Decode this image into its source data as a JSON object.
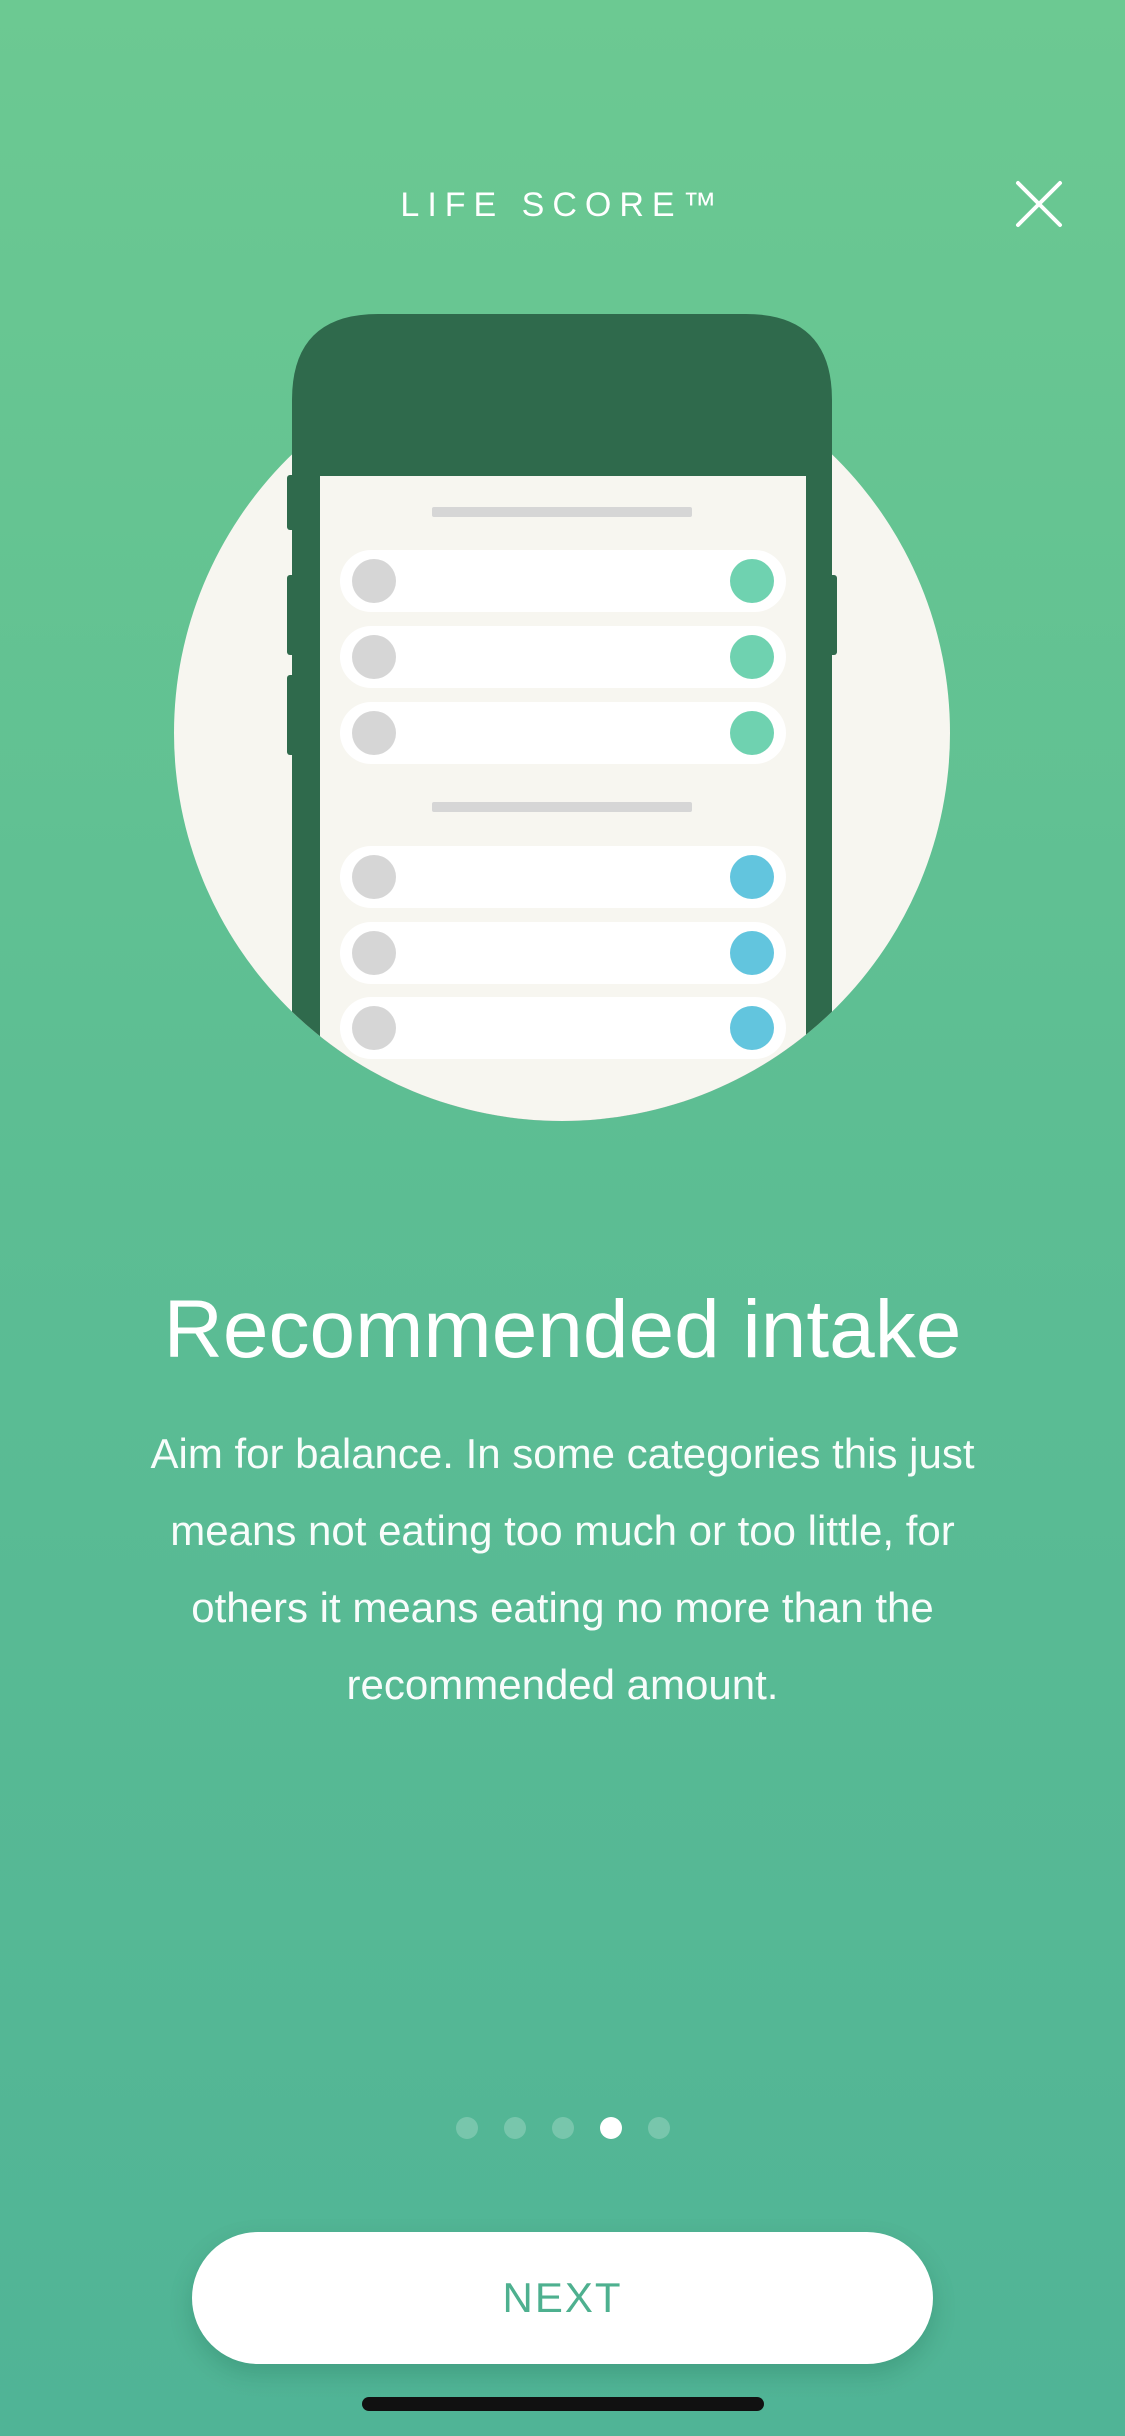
{
  "header": {
    "title": "LIFE SCORE™",
    "close_icon": "close-icon"
  },
  "content": {
    "title": "Recommended intake",
    "description": "Aim for balance. In some categories this just means not eating too much or too little, for others it means eating no more than the recommended amount."
  },
  "illustration": {
    "icon": "phone-list-illustration",
    "colors": {
      "circle": "#f7f6f0",
      "phone_body": "#2f6a4c",
      "row_bg": "#ffffff",
      "left_dot": "#d6d6d6",
      "green_dot": "#6fd2b0",
      "blue_dot": "#62c5de",
      "divider": "#d6d6d6"
    }
  },
  "pagination": {
    "total": 5,
    "active_index": 3
  },
  "next_button": {
    "label": "NEXT"
  },
  "colors": {
    "background_top": "#6cc992",
    "background_bottom": "#50b496",
    "accent": "#4eb08f"
  }
}
